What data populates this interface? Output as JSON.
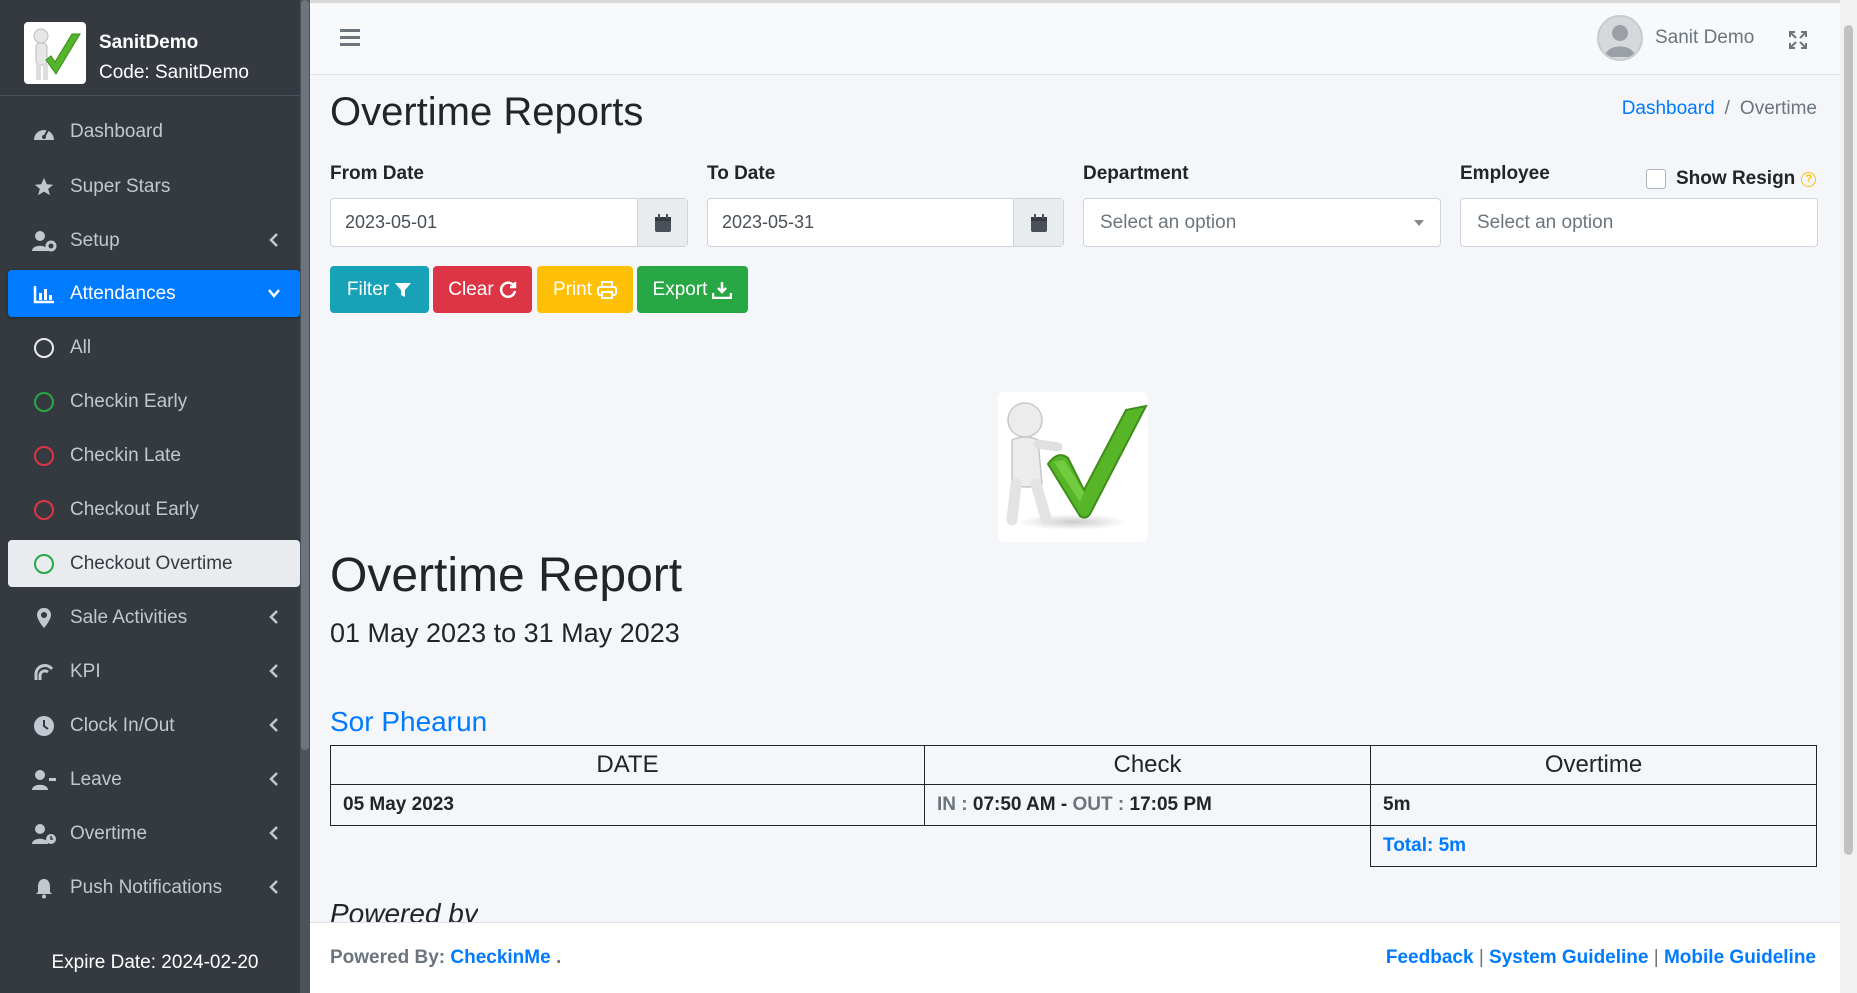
{
  "brand": {
    "name": "SanitDemo",
    "code": "Code: SanitDemo"
  },
  "sidebar": {
    "items": [
      {
        "label": "Dashboard",
        "icon": "dashboard-icon"
      },
      {
        "label": "Super Stars",
        "icon": "star-icon"
      },
      {
        "label": "Setup",
        "icon": "user-gear-icon"
      },
      {
        "label": "Attendances",
        "icon": "chart-bar-icon"
      },
      {
        "label": "All",
        "icon": "circle-icon"
      },
      {
        "label": "Checkin Early",
        "icon": "circle-icon"
      },
      {
        "label": "Checkin Late",
        "icon": "circle-icon"
      },
      {
        "label": "Checkout Early",
        "icon": "circle-icon"
      },
      {
        "label": "Checkout Overtime",
        "icon": "circle-icon"
      },
      {
        "label": "Sale Activities",
        "icon": "map-marker-icon"
      },
      {
        "label": "KPI",
        "icon": "gauge-icon"
      },
      {
        "label": "Clock In/Out",
        "icon": "clock-icon"
      },
      {
        "label": "Leave",
        "icon": "user-minus-icon"
      },
      {
        "label": "Overtime",
        "icon": "user-clock-icon"
      },
      {
        "label": "Push Notifications",
        "icon": "bell-icon"
      }
    ],
    "expire": "Expire Date: 2024-02-20"
  },
  "topbar": {
    "user_name": "Sanit Demo"
  },
  "page": {
    "title": "Overtime Reports",
    "breadcrumb": {
      "home": "Dashboard",
      "sep": "/",
      "current": "Overtime"
    }
  },
  "filters": {
    "from_label": "From Date",
    "from_value": "2023-05-01",
    "to_label": "To Date",
    "to_value": "2023-05-31",
    "dept_label": "Department",
    "dept_placeholder": "Select an option",
    "emp_label": "Employee",
    "emp_placeholder": "Select an option",
    "show_resign": "Show Resign",
    "help": "?"
  },
  "buttons": {
    "filter": "Filter",
    "clear": "Clear",
    "print": "Print",
    "export": "Export"
  },
  "colors": {
    "filter": "#17a2b8",
    "clear": "#dc3545",
    "print": "#ffc107",
    "export": "#28a745",
    "accent": "#007bff"
  },
  "report": {
    "title": "Overtime Report",
    "range": "01 May 2023 to 31 May 2023",
    "employee": "Sor Phearun",
    "headers": [
      "DATE",
      "Check",
      "Overtime"
    ],
    "rows": [
      {
        "date": "05 May 2023",
        "in_label": "IN :",
        "in_time": "07:50 AM",
        "dash": "-",
        "out_label": "OUT :",
        "out_time": "17:05 PM",
        "overtime": "5m"
      }
    ],
    "total": "Total: 5m",
    "powered_cut": "Powered by"
  },
  "footer": {
    "powered_label": "Powered By:",
    "powered_link": "CheckinMe",
    "powered_dot": ".",
    "links": [
      "Feedback",
      "System Guideline",
      "Mobile Guideline"
    ],
    "sep": "|"
  }
}
